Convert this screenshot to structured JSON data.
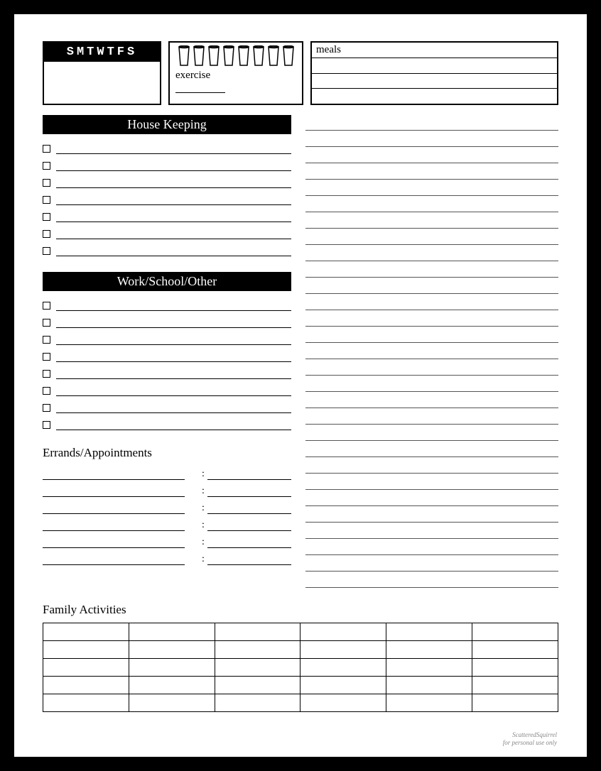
{
  "days_label": "SMTWTFS",
  "water_cup_count": 8,
  "exercise_label": "exercise",
  "meals_label": "meals",
  "meals_line_count": 3,
  "sections": {
    "housekeeping": {
      "title": "House Keeping",
      "rows": 7
    },
    "work": {
      "title": "Work/School/Other",
      "rows": 8
    },
    "errands": {
      "title": "Errands/Appointments",
      "left_lines": 6,
      "time_rows": 6
    },
    "family": {
      "title": "Family Activities",
      "cols": 6,
      "rows": 5
    }
  },
  "notes_line_count": 29,
  "footer": {
    "line1": "ScatteredSquirrel",
    "line2": "for personal use only"
  }
}
